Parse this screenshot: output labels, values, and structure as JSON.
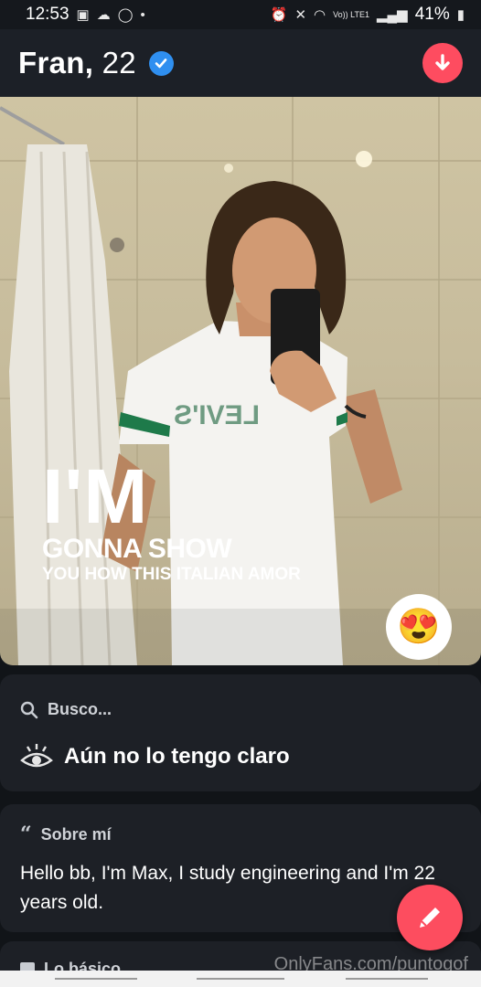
{
  "status_bar": {
    "time": "12:53",
    "battery": "41%",
    "left_icons": [
      "image-icon",
      "cloud-icon",
      "whatsapp-icon",
      "dot-icon"
    ],
    "right_icons": [
      "alarm-icon",
      "mute-icon",
      "wifi-icon",
      "signal-icon",
      "battery-icon"
    ],
    "network_label": "Vo)) LTE1"
  },
  "profile": {
    "name": "Fran,",
    "age": "22",
    "verified": true
  },
  "photo": {
    "overlay_big": "I'M",
    "overlay_mid": "GONNA SHOW",
    "overlay_small": "YOU HOW THIS ITALIAN AMOR",
    "shirt_text": "LEVI'S",
    "reaction_emoji": "😍"
  },
  "looking_for": {
    "title": "Busco...",
    "value": "Aún no lo tengo claro"
  },
  "about": {
    "title": "Sobre mí",
    "text": "Hello bb, I'm Max, I study engineering and I'm 22 years old."
  },
  "basics": {
    "title": "Lo básico"
  },
  "watermark": "OnlyFans.com/puntogof",
  "colors": {
    "accent": "#fe4c60",
    "verified": "#2f8ff0",
    "background": "#111418",
    "card": "#1d2026"
  }
}
